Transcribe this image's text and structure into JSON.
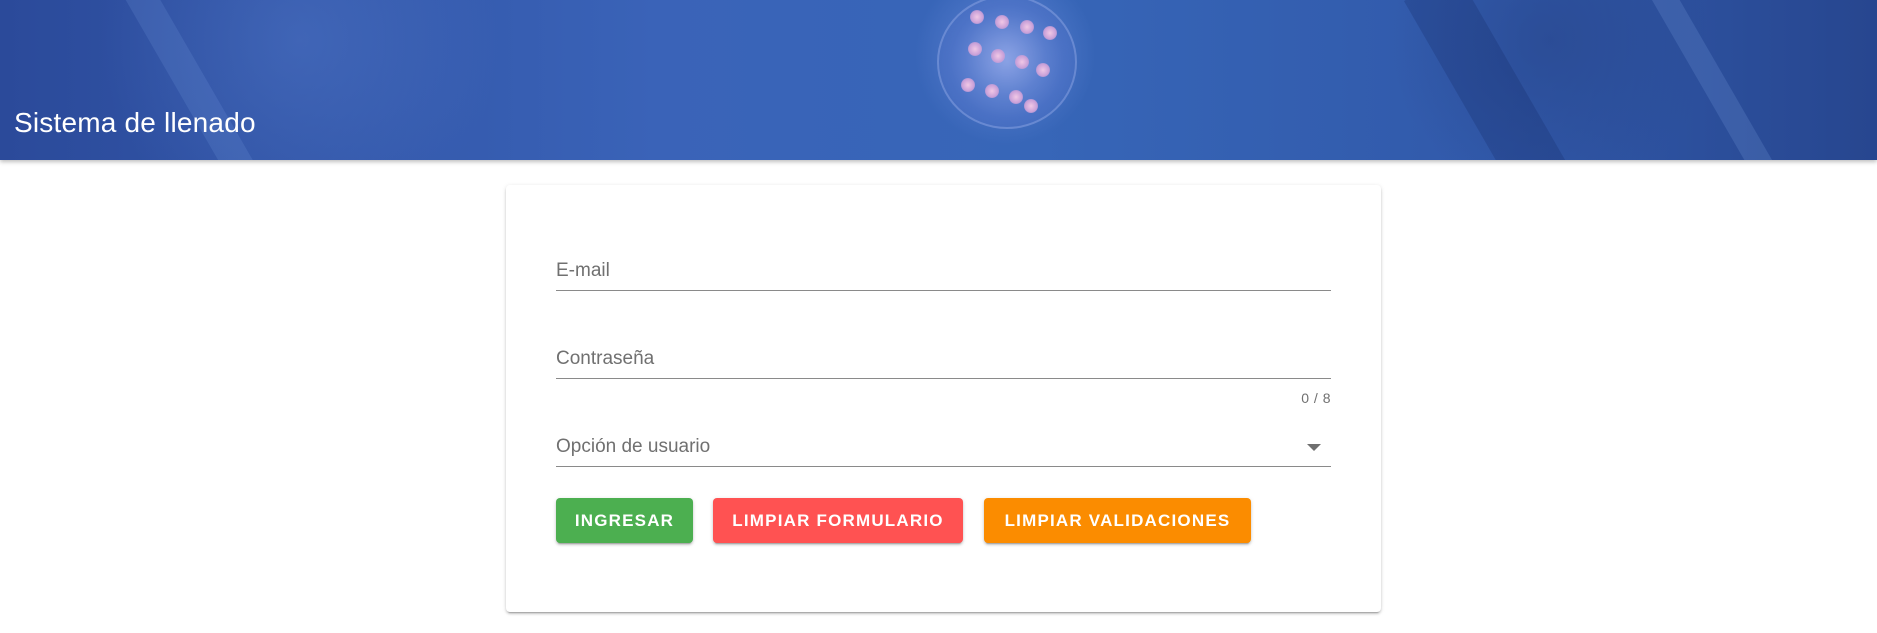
{
  "header": {
    "title": "Sistema de llenado"
  },
  "form": {
    "email_label": "E-mail",
    "email_value": "",
    "password_label": "Contraseña",
    "password_value": "",
    "password_counter": "0 / 8",
    "user_option_label": "Opción de usuario",
    "user_option_value": ""
  },
  "buttons": {
    "submit_label": "INGRESAR",
    "reset_label": "LIMPIAR FORMULARIO",
    "reset_validation_label": "LIMPIAR VALIDACIONES"
  },
  "colors": {
    "submit": "#4caf50",
    "reset": "#ff5252",
    "reset_validation": "#fb8c00",
    "header": "#3a63b8"
  },
  "icons": {
    "select_caret": "chevron-down-icon"
  }
}
